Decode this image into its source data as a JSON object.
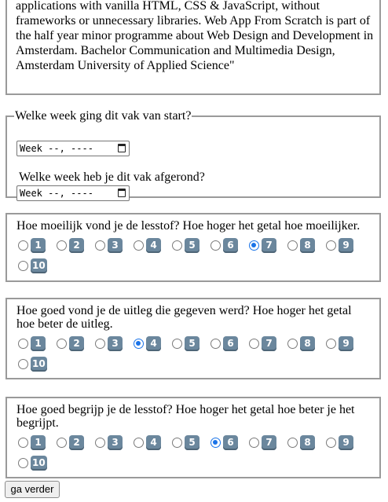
{
  "intro": {
    "text": "applications with vanilla HTML, CSS & JavaScript, without frameworks or unnecessary libraries. Web App From Scratch is part of the half year minor programme about Web Design and Development in Amsterdam. Bachelor Communication and Multimedia Design, Amsterdam University of Applied Science\""
  },
  "weeks": {
    "legend": "Welke week ging dit vak van start?",
    "start_value": "Week --, ----",
    "end_label": "Welke week heb je dit vak afgerond?",
    "end_value": "Week --, ----"
  },
  "ratings": [
    {
      "question": "Hoe moeilijk vond je de lesstof? Hoe hoger het getal hoe moeilijker.",
      "selected": "7",
      "options": [
        "1",
        "2",
        "3",
        "4",
        "5",
        "6",
        "7",
        "8",
        "9",
        "10"
      ]
    },
    {
      "question": "Hoe goed vond je de uitleg die gegeven werd? Hoe hoger het getal hoe beter de uitleg.",
      "selected": "4",
      "options": [
        "1",
        "2",
        "3",
        "4",
        "5",
        "6",
        "7",
        "8",
        "9",
        "10"
      ]
    },
    {
      "question": "Hoe goed begrijp je de lesstof? Hoe hoger het getal hoe beter je het begrijpt.",
      "selected": "6",
      "options": [
        "1",
        "2",
        "3",
        "4",
        "5",
        "6",
        "7",
        "8",
        "9",
        "10"
      ]
    }
  ],
  "submit_label": "ga verder",
  "colors": {
    "radio_accent": "#1a73e8",
    "keycap": "#6b879d"
  }
}
